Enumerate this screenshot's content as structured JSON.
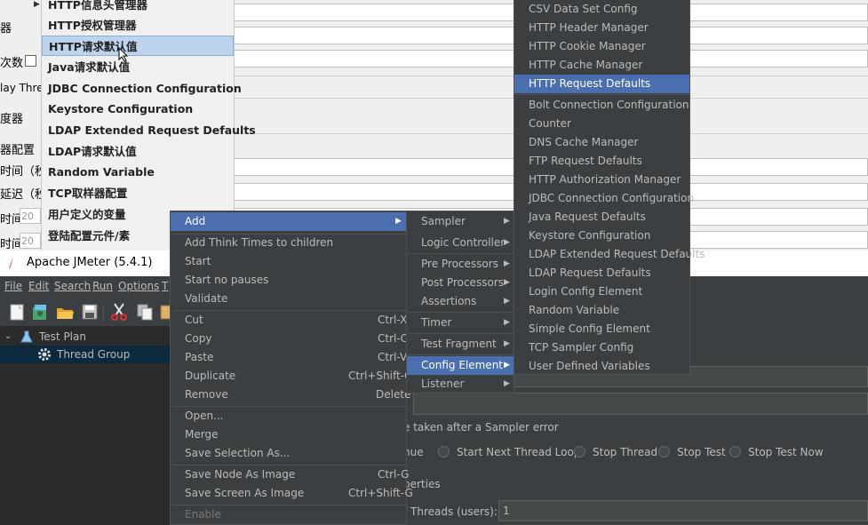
{
  "background_window": {
    "left_labels": [
      "器",
      "次数",
      "lay Thre",
      "度器",
      "器配置",
      "时间（秒",
      "延迟（秒",
      "时间",
      "时间"
    ],
    "small_field_values": [
      "20",
      "20"
    ],
    "menu_items": [
      "HTTP信息头管理器",
      "HTTP授权管理器",
      "HTTP请求默认值",
      "Java请求默认值",
      "JDBC Connection Configuration",
      "Keystore Configuration",
      "LDAP Extended Request Defaults",
      "LDAP请求默认值",
      "Random Variable",
      "TCP取样器配置",
      "用户定义的变量",
      "登陆配置元件/素"
    ]
  },
  "window": {
    "title": "Apache JMeter (5.4.1)"
  },
  "menubar": {
    "items": [
      "File",
      "Edit",
      "Search",
      "Run",
      "Options",
      "T"
    ]
  },
  "toolbar": {
    "icons": [
      "new-icon",
      "templates-icon",
      "open-icon",
      "save-icon",
      "cut-icon",
      "copy-icon",
      "paste-icon"
    ]
  },
  "tree": {
    "items": [
      {
        "label": "Test Plan",
        "icon": "test-plan-icon"
      },
      {
        "label": "Thread Group",
        "icon": "gear-icon"
      }
    ]
  },
  "right_panel": {
    "error_section_label": "e taken after a Sampler error",
    "radio_options": [
      "nue",
      "Start Next Thread Loop",
      "Stop Thread",
      "Stop Test",
      "Stop Test Now"
    ],
    "properties_label": "perties",
    "threads_label": "f Threads (users):",
    "threads_value": "1"
  },
  "context_menu": {
    "items": [
      {
        "label": "Add",
        "submenu": true
      },
      {
        "label": "Add Think Times to children"
      },
      {
        "label": "Start"
      },
      {
        "label": "Start no pauses"
      },
      {
        "label": "Validate"
      },
      {
        "label": "Cut",
        "shortcut": "Ctrl-X"
      },
      {
        "label": "Copy",
        "shortcut": "Ctrl-C"
      },
      {
        "label": "Paste",
        "shortcut": "Ctrl-V"
      },
      {
        "label": "Duplicate",
        "shortcut": "Ctrl+Shift-C"
      },
      {
        "label": "Remove",
        "shortcut": "Delete"
      },
      {
        "label": "Open..."
      },
      {
        "label": "Merge"
      },
      {
        "label": "Save Selection As..."
      },
      {
        "label": "Save Node As Image",
        "shortcut": "Ctrl-G"
      },
      {
        "label": "Save Screen As Image",
        "shortcut": "Ctrl+Shift-G"
      },
      {
        "label": "Enable",
        "disabled": true
      }
    ]
  },
  "add_submenu": {
    "items": [
      {
        "label": "Sampler"
      },
      {
        "label": "Logic Controller"
      },
      {
        "label": "Pre Processors"
      },
      {
        "label": "Post Processors"
      },
      {
        "label": "Assertions"
      },
      {
        "label": "Timer"
      },
      {
        "label": "Test Fragment"
      },
      {
        "label": "Config Element"
      },
      {
        "label": "Listener"
      }
    ]
  },
  "config_submenu": {
    "items": [
      "CSV Data Set Config",
      "HTTP Header Manager",
      "HTTP Cookie Manager",
      "HTTP Cache Manager",
      "HTTP Request Defaults",
      "Bolt Connection Configuration",
      "Counter",
      "DNS Cache Manager",
      "FTP Request Defaults",
      "HTTP Authorization Manager",
      "JDBC Connection Configuration",
      "Java Request Defaults",
      "Keystore Configuration",
      "LDAP Extended Request Defaults",
      "LDAP Request Defaults",
      "Login Config Element",
      "Random Variable",
      "Simple Config Element",
      "TCP Sampler Config",
      "User Defined Variables"
    ]
  },
  "colors": {
    "highlight": "#4b6eaf",
    "menu_bg": "#3c3f41",
    "tree_bg": "#2b2b2b"
  }
}
